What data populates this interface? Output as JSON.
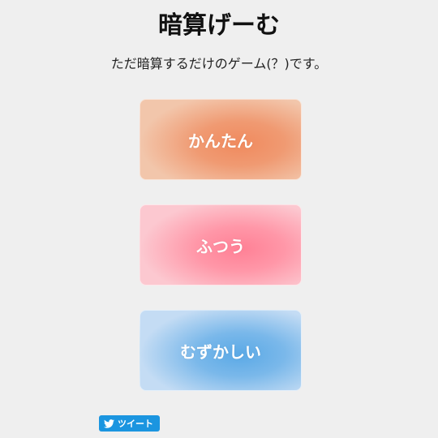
{
  "header": {
    "title": "暗算げーむ",
    "subtitle": "ただ暗算するだけのゲーム(？)です。"
  },
  "levels": [
    {
      "label": "かんたん",
      "color": "#f08a5e"
    },
    {
      "label": "ふつう",
      "color": "#ff8095"
    },
    {
      "label": "むずかしい",
      "color": "#5aa9e6"
    }
  ],
  "share": {
    "tweet_label": "ツイート",
    "icon": "twitter-bird-icon",
    "color": "#1b95e0"
  }
}
